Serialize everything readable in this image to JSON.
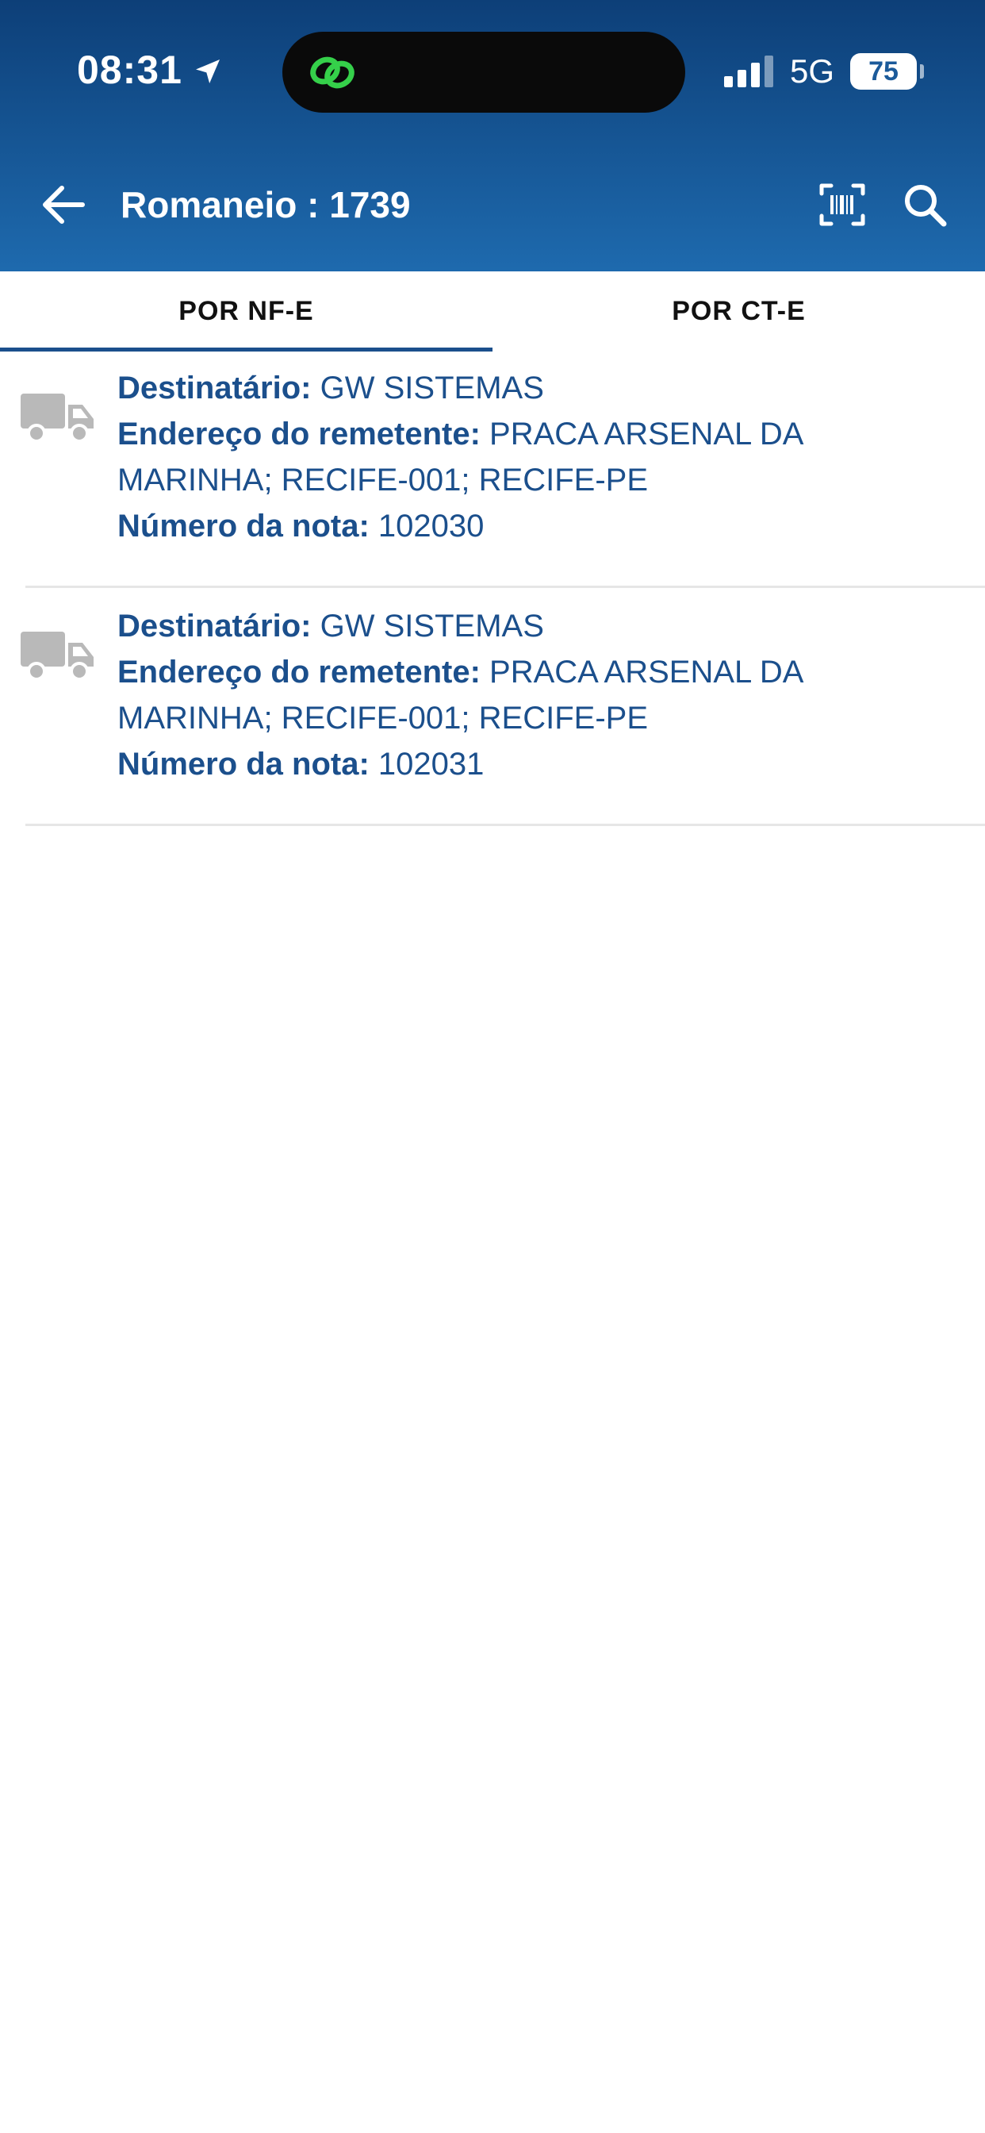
{
  "status_bar": {
    "time": "08:31",
    "network": "5G",
    "battery": "75"
  },
  "app_bar": {
    "title": "Romaneio : 1739"
  },
  "tabs": [
    {
      "label": "POR NF-E",
      "selected": true
    },
    {
      "label": "POR CT-E",
      "selected": false
    }
  ],
  "labels": {
    "recipient": "Destinatário:",
    "sender_address": "Endereço do remetente:",
    "invoice_number": "Número da nota:"
  },
  "items": [
    {
      "recipient": "GW SISTEMAS",
      "address_line1": "PRACA ARSENAL DA",
      "address_line2": "MARINHA; RECIFE-001; RECIFE-PE",
      "invoice_number": "102030"
    },
    {
      "recipient": "GW SISTEMAS",
      "address_line1": "PRACA ARSENAL DA",
      "address_line2": "MARINHA; RECIFE-001; RECIFE-PE",
      "invoice_number": "102031"
    }
  ],
  "colors": {
    "header_top": "#0d3f78",
    "header_bottom": "#1e6aae",
    "text_primary": "#1b4f8c",
    "icon_gray": "#b9b9b9",
    "island_green": "#35d04a"
  },
  "icons": {
    "back": "arrow-left-icon",
    "scan": "barcode-scan-icon",
    "search": "search-icon",
    "item": "truck-icon",
    "location": "location-arrow-icon",
    "island": "link-rings-icon"
  }
}
